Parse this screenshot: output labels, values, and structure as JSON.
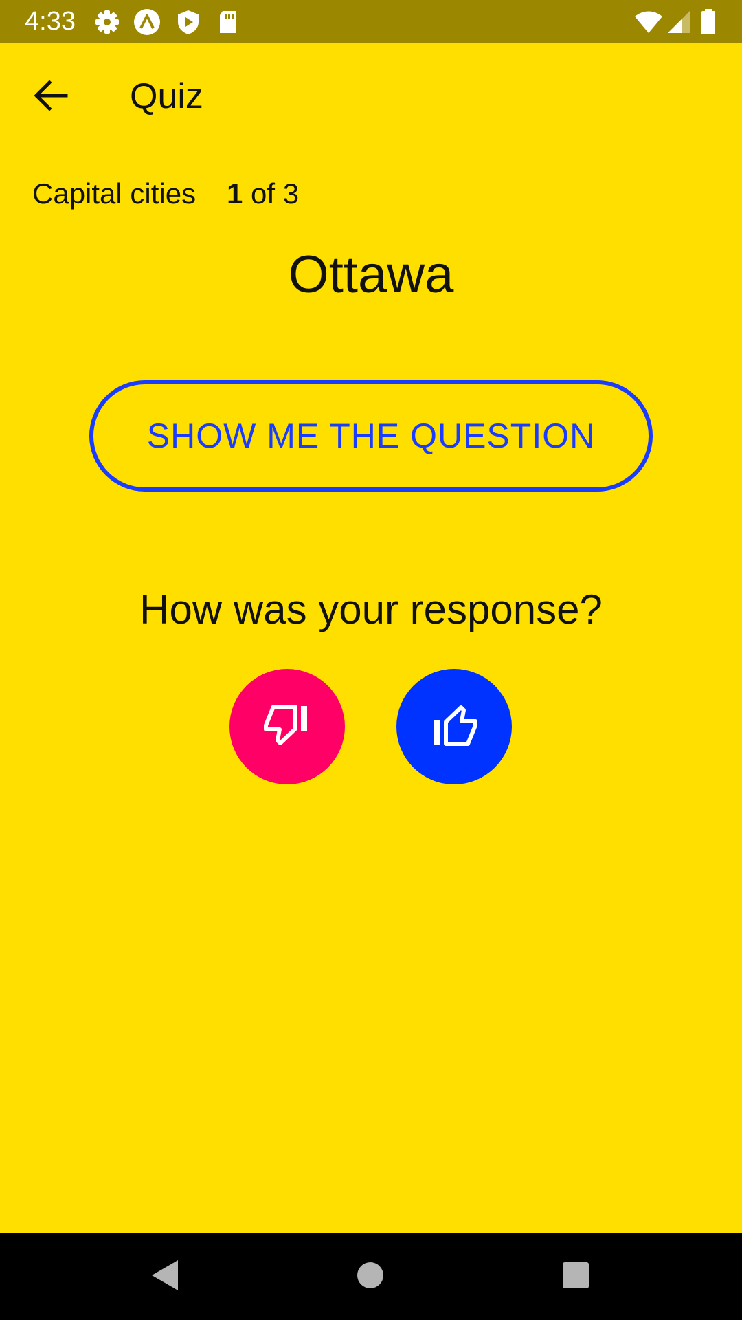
{
  "status_bar": {
    "time": "4:33",
    "icons": [
      "settings-icon",
      "app-logo-icon",
      "shield-icon",
      "sd-card-icon",
      "wifi-icon",
      "signal-icon",
      "battery-icon"
    ]
  },
  "app_bar": {
    "title": "Quiz"
  },
  "quiz": {
    "deck_name": "Capital cities",
    "progress_current": "1",
    "progress_rest": "of 3",
    "answer": "Ottawa",
    "show_question_label": "SHOW ME THE QUESTION",
    "response_prompt": "How was your response?"
  },
  "colors": {
    "background": "#FFDF00",
    "status_bar": "#9C8700",
    "accent_blue": "#1A3CFF",
    "thumbs_down": "#FF0066",
    "thumbs_up": "#0033FF"
  },
  "nav": {
    "icons": [
      "back-triangle-icon",
      "home-circle-icon",
      "recents-square-icon"
    ]
  }
}
